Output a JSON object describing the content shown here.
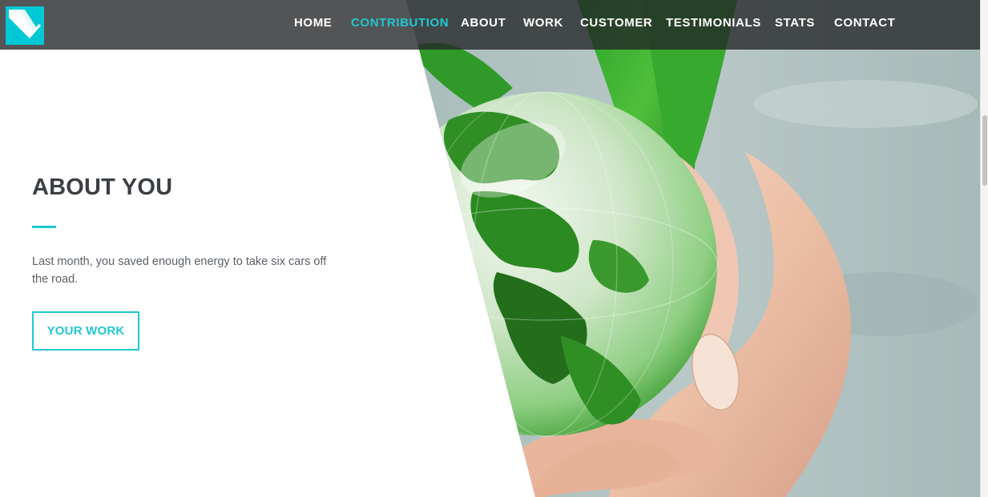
{
  "brand": {
    "logo_icon": "brand-logo-icon",
    "accent_color": "#1fc8d0"
  },
  "nav": {
    "items": [
      {
        "label": "HOME",
        "active": false
      },
      {
        "label": "CONTRIBUTION",
        "active": true
      },
      {
        "label": "ABOUT",
        "active": false
      },
      {
        "label": "WORK",
        "active": false
      },
      {
        "label": "CUSTOMER",
        "active": false
      },
      {
        "label": "TESTIMONIALS",
        "active": false
      },
      {
        "label": "STATS",
        "active": false
      },
      {
        "label": "CONTACT",
        "active": false
      }
    ]
  },
  "about": {
    "title": "ABOUT YOU",
    "text": "Last month, you saved enough energy to take six cars off the road.",
    "button_label": "YOUR WORK"
  },
  "hero": {
    "image": "hand-holding-green-globe-photo"
  }
}
